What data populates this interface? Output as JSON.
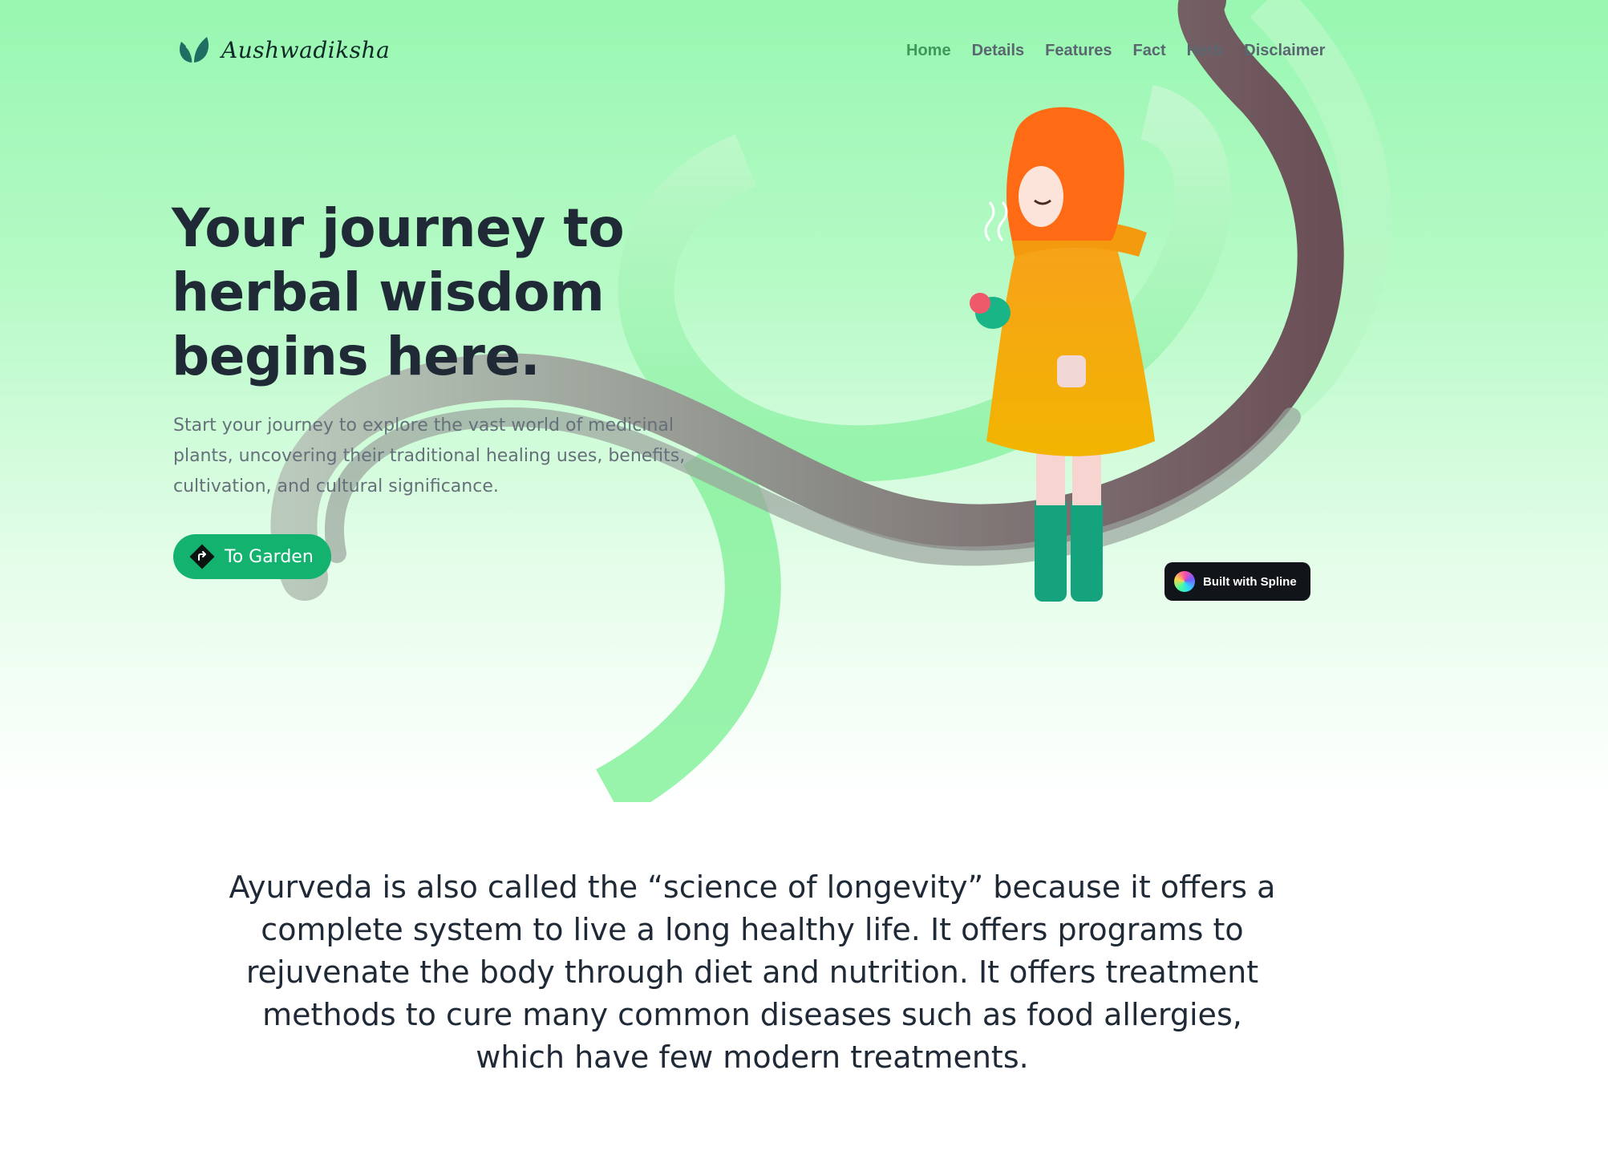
{
  "brand": {
    "name": "Aushwadiksha",
    "logo_icon": "leaf-icon",
    "accent_color": "#13b36f"
  },
  "nav": {
    "items": [
      {
        "label": "Home",
        "active": true
      },
      {
        "label": "Details",
        "active": false
      },
      {
        "label": "Features",
        "active": false
      },
      {
        "label": "Fact",
        "active": false
      },
      {
        "label": "Herb",
        "active": false
      },
      {
        "label": "Disclaimer",
        "active": false
      }
    ]
  },
  "hero": {
    "headline": "Your journey to herbal wisdom begins here.",
    "subtext": "Start your journey to explore the vast world of medicinal plants, uncovering their traditional healing uses, benefits, cultivation, and cultural significance.",
    "cta_label": "To Garden",
    "cta_icon": "direction-arrow-icon",
    "badge_label": "Built with Spline"
  },
  "about": {
    "text": "Ayurveda is also called the “science of longevity” because it offers a complete system to live a long healthy life. It offers programs to rejuvenate the body through diet and nutrition. It offers treatment methods to cure many common diseases such as food allergies, which have few modern treatments."
  }
}
